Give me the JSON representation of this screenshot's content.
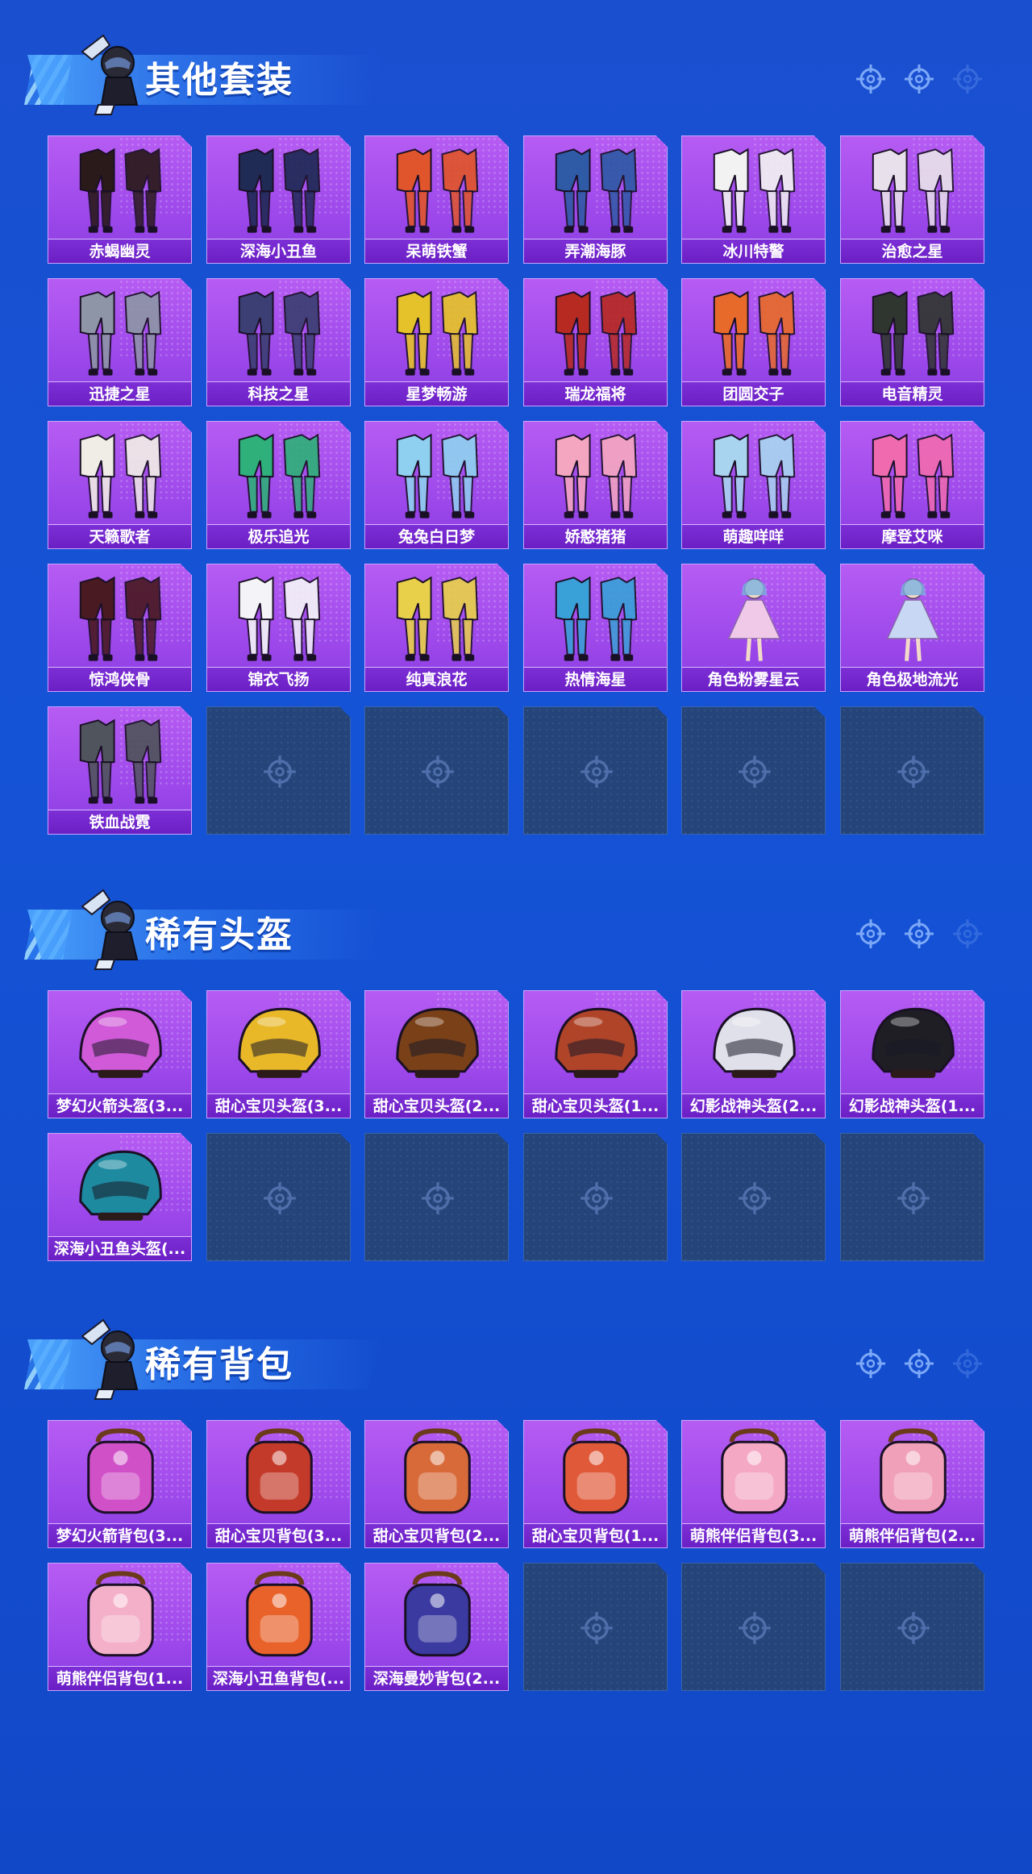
{
  "colors": {
    "background": "#1553d6",
    "card": "#9b47ea",
    "card_label": "#6a1fc4",
    "empty_slot": "#25457a"
  },
  "sections": [
    {
      "title": "其他套装",
      "items": [
        {
          "name": "赤蝎幽灵",
          "icon": "outfit-icon",
          "accent": "#2a1a1a"
        },
        {
          "name": "深海小丑鱼",
          "icon": "outfit-icon",
          "accent": "#1f2a55"
        },
        {
          "name": "呆萌铁蟹",
          "icon": "outfit-icon",
          "accent": "#e0552b"
        },
        {
          "name": "弄潮海豚",
          "icon": "outfit-icon",
          "accent": "#2f5aa6"
        },
        {
          "name": "冰川特警",
          "icon": "outfit-icon",
          "accent": "#f2f2f2"
        },
        {
          "name": "治愈之星",
          "icon": "outfit-icon",
          "accent": "#e8e0ea"
        },
        {
          "name": "迅捷之星",
          "icon": "outfit-icon",
          "accent": "#8d95a6"
        },
        {
          "name": "科技之星",
          "icon": "outfit-icon",
          "accent": "#3b3f73"
        },
        {
          "name": "星梦畅游",
          "icon": "outfit-icon",
          "accent": "#e5c22a"
        },
        {
          "name": "瑞龙福将",
          "icon": "outfit-icon",
          "accent": "#b62a22"
        },
        {
          "name": "团圆交子",
          "icon": "outfit-icon",
          "accent": "#e86a2a"
        },
        {
          "name": "电音精灵",
          "icon": "outfit-icon",
          "accent": "#2f3630"
        },
        {
          "name": "天籁歌者",
          "icon": "outfit-icon",
          "accent": "#f0ece6"
        },
        {
          "name": "极乐追光",
          "icon": "outfit-icon",
          "accent": "#2fb07a"
        },
        {
          "name": "兔兔白日梦",
          "icon": "outfit-icon",
          "accent": "#8fd0f0"
        },
        {
          "name": "娇憨猪猪",
          "icon": "outfit-icon",
          "accent": "#f4a6c0"
        },
        {
          "name": "萌趣咩咩",
          "icon": "outfit-icon",
          "accent": "#a8d4f0"
        },
        {
          "name": "摩登艾咪",
          "icon": "outfit-icon",
          "accent": "#f06ab0"
        },
        {
          "name": "惊鸿侠骨",
          "icon": "outfit-icon",
          "accent": "#4a1a22"
        },
        {
          "name": "锦衣飞扬",
          "icon": "outfit-icon",
          "accent": "#f4f4f8"
        },
        {
          "name": "纯真浪花",
          "icon": "outfit-icon",
          "accent": "#e8d04a"
        },
        {
          "name": "热情海星",
          "icon": "outfit-icon",
          "accent": "#3aa0d8"
        },
        {
          "name": "角色粉雾星云",
          "icon": "character-icon",
          "accent": "#f0c8e8"
        },
        {
          "name": "角色极地流光",
          "icon": "character-icon",
          "accent": "#c8d8f4"
        },
        {
          "name": "铁血战霓",
          "icon": "outfit-icon",
          "accent": "#50545c"
        }
      ],
      "empty_slots": 5
    },
    {
      "title": "稀有头盔",
      "items": [
        {
          "name": "梦幻火箭头盔(3...",
          "icon": "helmet-icon",
          "accent": "#d05ad8"
        },
        {
          "name": "甜心宝贝头盔(3...",
          "icon": "helmet-icon",
          "accent": "#e8b828"
        },
        {
          "name": "甜心宝贝头盔(2...",
          "icon": "helmet-icon",
          "accent": "#7a4018"
        },
        {
          "name": "甜心宝贝头盔(1...",
          "icon": "helmet-icon",
          "accent": "#b04428"
        },
        {
          "name": "幻影战神头盔(2...",
          "icon": "helmet-icon",
          "accent": "#e0e0ea"
        },
        {
          "name": "幻影战神头盔(1...",
          "icon": "helmet-icon",
          "accent": "#1e1e24"
        },
        {
          "name": "深海小丑鱼头盔(...",
          "icon": "helmet-icon",
          "accent": "#1e8aa0"
        }
      ],
      "empty_slots": 5
    },
    {
      "title": "稀有背包",
      "items": [
        {
          "name": "梦幻火箭背包(3...",
          "icon": "backpack-icon",
          "accent": "#d050c8"
        },
        {
          "name": "甜心宝贝背包(3...",
          "icon": "backpack-icon",
          "accent": "#c43a2a"
        },
        {
          "name": "甜心宝贝背包(2...",
          "icon": "backpack-icon",
          "accent": "#d86a3a"
        },
        {
          "name": "甜心宝贝背包(1...",
          "icon": "backpack-icon",
          "accent": "#e05a3a"
        },
        {
          "name": "萌熊伴侣背包(3...",
          "icon": "backpack-icon",
          "accent": "#f4a8c4"
        },
        {
          "name": "萌熊伴侣背包(2...",
          "icon": "backpack-icon",
          "accent": "#f0a0b8"
        },
        {
          "name": "萌熊伴侣背包(1...",
          "icon": "backpack-icon",
          "accent": "#f4b0c8"
        },
        {
          "name": "深海小丑鱼背包(...",
          "icon": "backpack-icon",
          "accent": "#e8622a"
        },
        {
          "name": "深海曼妙背包(2...",
          "icon": "backpack-icon",
          "accent": "#3a3aa0"
        }
      ],
      "empty_slots": 3
    }
  ]
}
